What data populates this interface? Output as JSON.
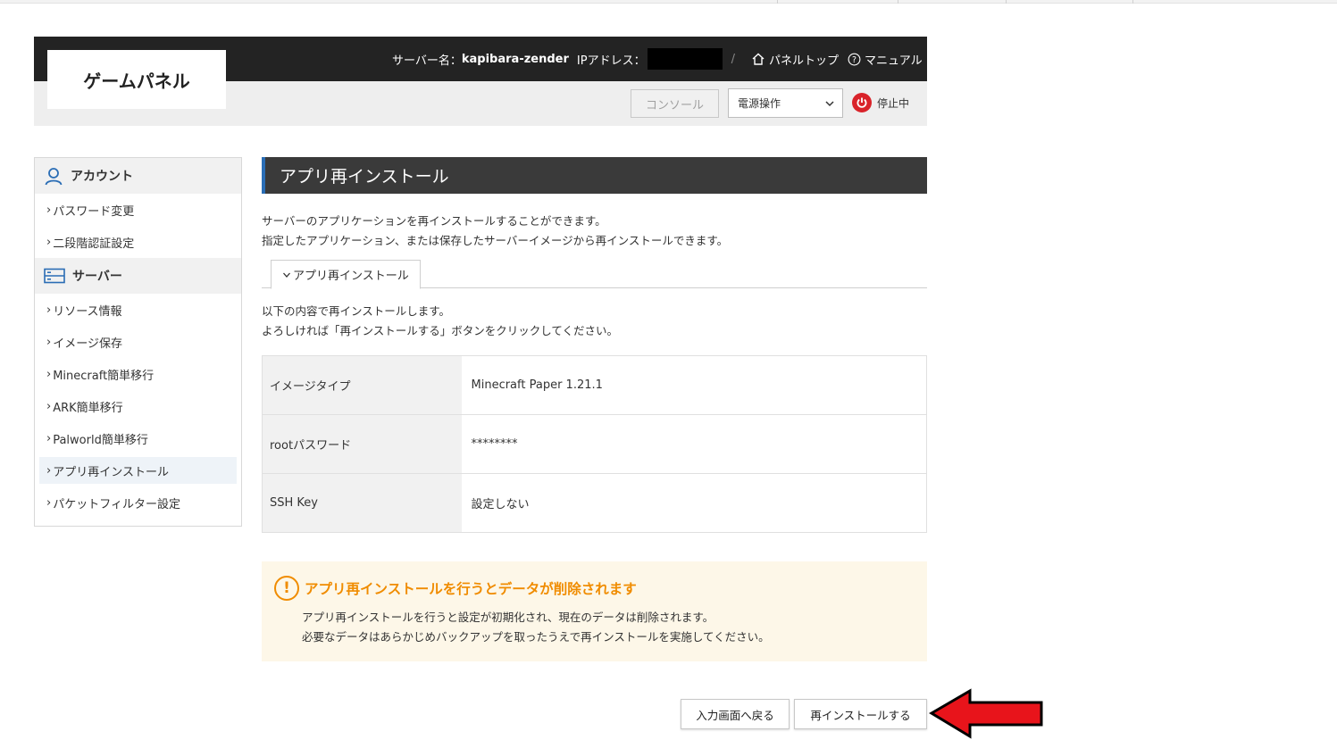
{
  "header": {
    "logo": "ゲームパネル",
    "server_label": "サーバー名：",
    "server_name": "kapibara-zender",
    "ip_label": "IPアドレス：",
    "separator": "/",
    "panel_top": "パネルトップ",
    "manual": "マニュアル",
    "console_button": "コンソール",
    "power_select": "電源操作",
    "status": "停止中"
  },
  "sidebar": {
    "account_heading": "アカウント",
    "account_items": [
      {
        "label": "パスワード変更"
      },
      {
        "label": "二段階認証設定"
      }
    ],
    "server_heading": "サーバー",
    "server_items": [
      {
        "label": "リソース情報"
      },
      {
        "label": "イメージ保存"
      },
      {
        "label": "Minecraft簡単移行"
      },
      {
        "label": "ARK簡単移行"
      },
      {
        "label": "Palworld簡単移行"
      },
      {
        "label": "アプリ再インストール"
      },
      {
        "label": "パケットフィルター設定"
      }
    ],
    "arrow_glyph": "›"
  },
  "main": {
    "title": "アプリ再インストール",
    "desc_line1": "サーバーのアプリケーションを再インストールすることができます。",
    "desc_line2": "指定したアプリケーション、または保存したサーバーイメージから再インストールできます。",
    "tab_label": "アプリ再インストール",
    "intro_line1": "以下の内容で再インストールします。",
    "intro_line2": "よろしければ「再インストールする」ボタンをクリックしてください。",
    "rows": [
      {
        "key": "イメージタイプ",
        "value": "Minecraft Paper 1.21.1"
      },
      {
        "key": "rootパスワード",
        "value": "********"
      },
      {
        "key": "SSH Key",
        "value": "設定しない"
      }
    ],
    "warning_title": "アプリ再インストールを行うとデータが削除されます",
    "warning_line1": "アプリ再インストールを行うと設定が初期化され、現在のデータは削除されます。",
    "warning_line2": "必要なデータはあらかじめバックアップを取ったうえで再インストールを実施してください。",
    "back_button": "入力画面へ戻る",
    "reinstall_button": "再インストールする"
  },
  "icons": {
    "home": "home-icon",
    "help": "help-circle-icon",
    "power": "power-icon",
    "account": "user-icon",
    "server": "server-icon",
    "warning": "exclamation-icon",
    "pointer": "red-arrow-icon"
  },
  "colors": {
    "header_bg": "#232323",
    "title_bar_bg": "#3a3a3a",
    "title_accent": "#2a6db5",
    "status_red": "#d9232a",
    "warning_orange": "#f08c00",
    "warning_bg": "#fdf7e8",
    "arrow_red": "#e8141b"
  }
}
